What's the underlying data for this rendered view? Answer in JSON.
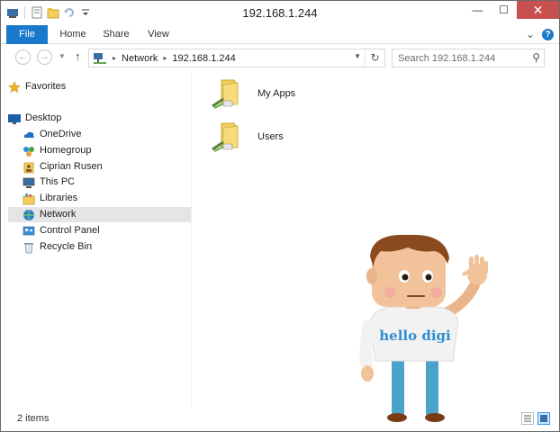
{
  "window": {
    "title": "192.168.1.244"
  },
  "caption_buttons": {
    "minimize": "—",
    "maximize": "☐",
    "close": "✕"
  },
  "ribbon": {
    "tabs": [
      "File",
      "Home",
      "Share",
      "View"
    ],
    "help": "?",
    "expand": "⌄"
  },
  "address": {
    "breadcrumb": [
      "Network",
      "192.168.1.244"
    ],
    "separator": "▸"
  },
  "search": {
    "placeholder": "Search 192.168.1.244"
  },
  "nav_pane": {
    "favorites": "Favorites",
    "items": [
      {
        "label": "Desktop",
        "icon": "desktop-icon"
      },
      {
        "label": "OneDrive",
        "icon": "onedrive-icon"
      },
      {
        "label": "Homegroup",
        "icon": "homegroup-icon"
      },
      {
        "label": "Ciprian Rusen",
        "icon": "user-folder-icon"
      },
      {
        "label": "This PC",
        "icon": "computer-icon"
      },
      {
        "label": "Libraries",
        "icon": "libraries-icon"
      },
      {
        "label": "Network",
        "icon": "network-icon",
        "selected": true
      },
      {
        "label": "Control Panel",
        "icon": "control-panel-icon"
      },
      {
        "label": "Recycle Bin",
        "icon": "recycle-bin-icon"
      }
    ]
  },
  "content": {
    "folders": [
      {
        "label": "My Apps",
        "icon": "shared-folder-icon"
      },
      {
        "label": "Users",
        "icon": "shared-folder-icon"
      }
    ]
  },
  "status_bar": {
    "item_count": "2 items"
  },
  "mascot": {
    "shirt_text": "hello digi"
  },
  "colors": {
    "accent": "#1979ca",
    "close": "#c75050",
    "folder": "#f2cf5b",
    "selection": "#e5e5e5"
  }
}
